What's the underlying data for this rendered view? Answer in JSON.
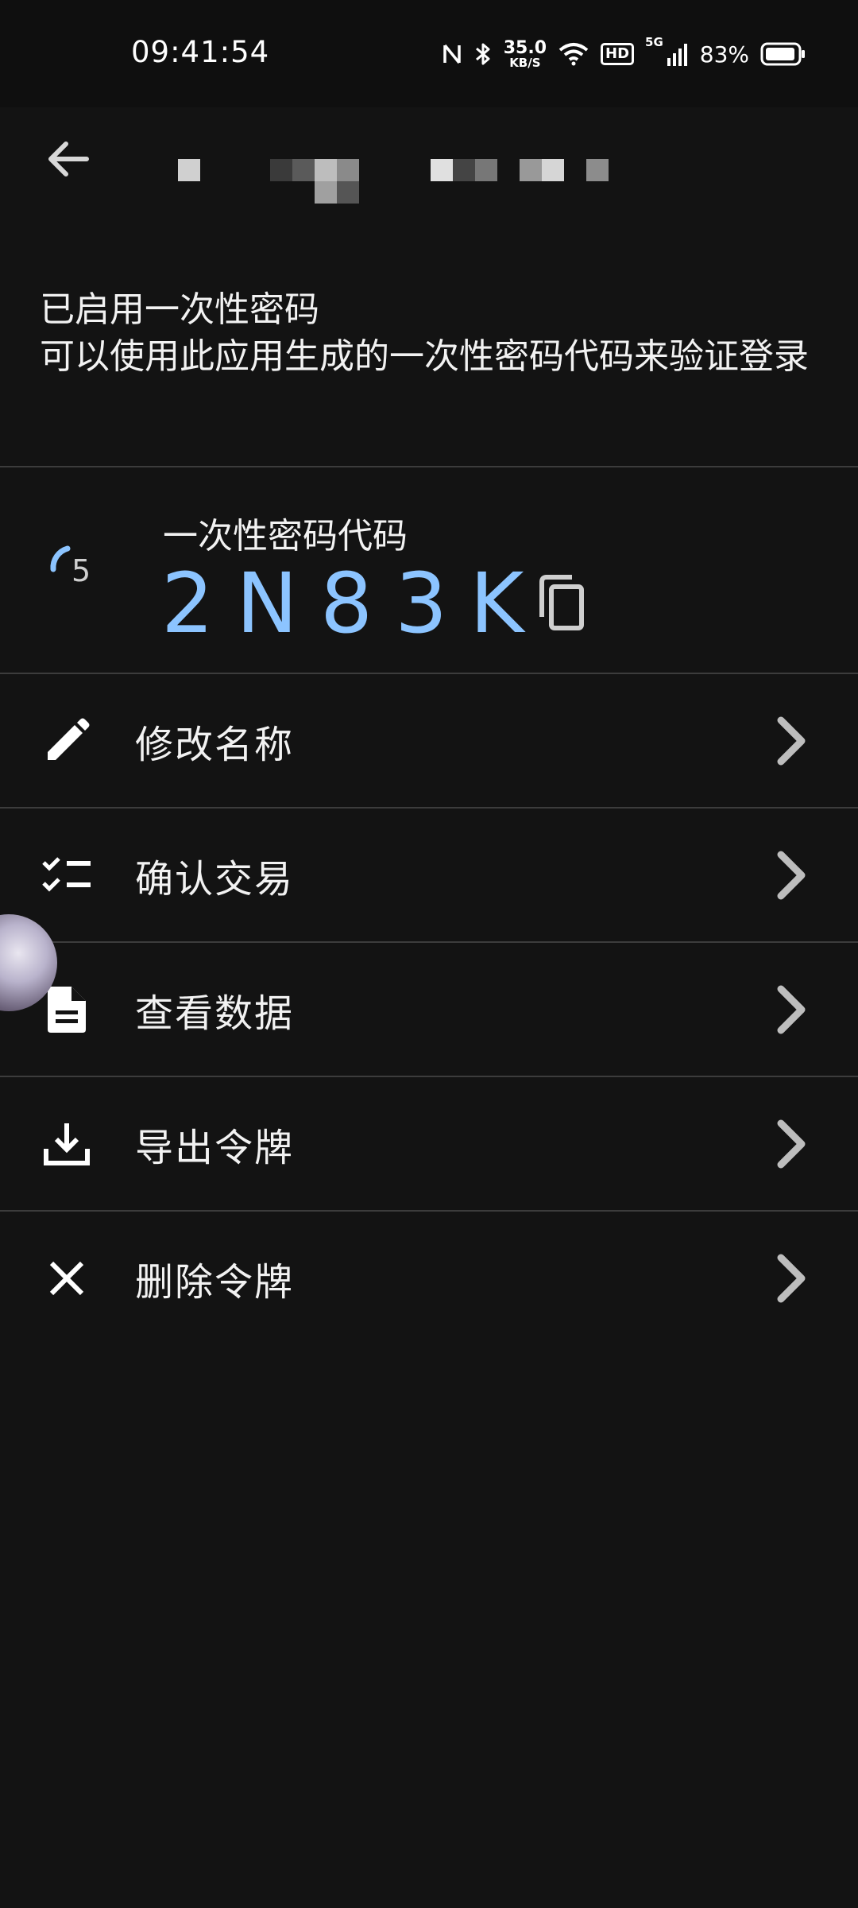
{
  "status_bar": {
    "time": "09:41:54",
    "net_speed_value": "35.0",
    "net_speed_unit": "KB/S",
    "hd_label": "HD",
    "network_label": "5G",
    "battery_percent": "83%"
  },
  "otp_header": {
    "title": "已启用一次性密码",
    "description": "可以使用此应用生成的一次性密码代码来验证登录"
  },
  "otp": {
    "label": "一次性密码代码",
    "code": "2N83K",
    "timer": "5",
    "accent_color": "#8cc4ff"
  },
  "menu": [
    {
      "label": "修改名称",
      "icon": "pencil-icon"
    },
    {
      "label": "确认交易",
      "icon": "checklist-icon"
    },
    {
      "label": "查看数据",
      "icon": "document-icon"
    },
    {
      "label": "导出令牌",
      "icon": "download-icon"
    },
    {
      "label": "删除令牌",
      "icon": "close-icon"
    }
  ]
}
